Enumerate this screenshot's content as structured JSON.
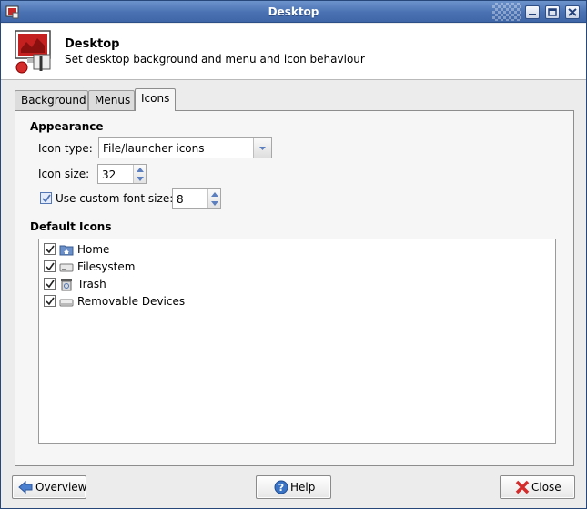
{
  "window": {
    "title": "Desktop"
  },
  "header": {
    "title": "Desktop",
    "subtitle": "Set desktop background and menu and icon behaviour"
  },
  "tabs": [
    {
      "label": "Background",
      "active": false
    },
    {
      "label": "Menus",
      "active": false
    },
    {
      "label": "Icons",
      "active": true
    }
  ],
  "appearance": {
    "heading": "Appearance",
    "icon_type_label": "Icon type:",
    "icon_type_value": "File/launcher icons",
    "icon_size_label": "Icon size:",
    "icon_size_value": "32",
    "custom_font_label": "Use custom font size:",
    "custom_font_checked": true,
    "custom_font_value": "8"
  },
  "default_icons": {
    "heading": "Default Icons",
    "items": [
      {
        "label": "Home",
        "checked": true,
        "icon": "home-folder-icon"
      },
      {
        "label": "Filesystem",
        "checked": true,
        "icon": "drive-icon"
      },
      {
        "label": "Trash",
        "checked": true,
        "icon": "trash-icon"
      },
      {
        "label": "Removable Devices",
        "checked": true,
        "icon": "removable-drive-icon"
      }
    ]
  },
  "buttons": {
    "overview": "Overview",
    "help": "Help",
    "close": "Close"
  },
  "colors": {
    "titlebar": "#4a72b3",
    "accent_red": "#d42b2b",
    "help_blue": "#3a73c4"
  }
}
